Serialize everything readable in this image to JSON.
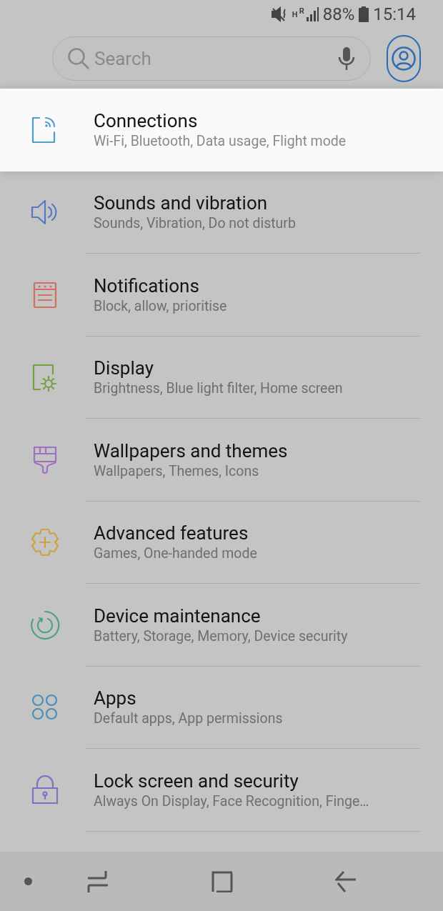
{
  "status_bar": {
    "network_type": "H",
    "roaming": "R",
    "battery": "88%",
    "time": "15:14"
  },
  "search": {
    "placeholder": "Search"
  },
  "items": [
    {
      "kind": "connections",
      "title": "Connections",
      "subtitle": "Wi-Fi, Bluetooth, Data usage, Flight mode",
      "color": "#4a9fd0",
      "selected": true
    },
    {
      "kind": "sounds",
      "title": "Sounds and vibration",
      "subtitle": "Sounds, Vibration, Do not disturb",
      "color": "#5a78c0",
      "selected": false
    },
    {
      "kind": "notifications",
      "title": "Notifications",
      "subtitle": "Block, allow, prioritise",
      "color": "#d07060",
      "selected": false
    },
    {
      "kind": "display",
      "title": "Display",
      "subtitle": "Brightness, Blue light filter, Home screen",
      "color": "#78a040",
      "selected": false
    },
    {
      "kind": "wallpapers",
      "title": "Wallpapers and themes",
      "subtitle": "Wallpapers, Themes, Icons",
      "color": "#a070c0",
      "selected": false
    },
    {
      "kind": "advanced",
      "title": "Advanced features",
      "subtitle": "Games, One-handed mode",
      "color": "#d0a040",
      "selected": false
    },
    {
      "kind": "maintenance",
      "title": "Device maintenance",
      "subtitle": "Battery, Storage, Memory, Device security",
      "color": "#50a088",
      "selected": false
    },
    {
      "kind": "apps",
      "title": "Apps",
      "subtitle": "Default apps, App permissions",
      "color": "#4a90b8",
      "selected": false
    },
    {
      "kind": "lock",
      "title": "Lock screen and security",
      "subtitle": "Always On Display, Face Recognition, Finge…",
      "color": "#8070c0",
      "selected": false
    }
  ]
}
